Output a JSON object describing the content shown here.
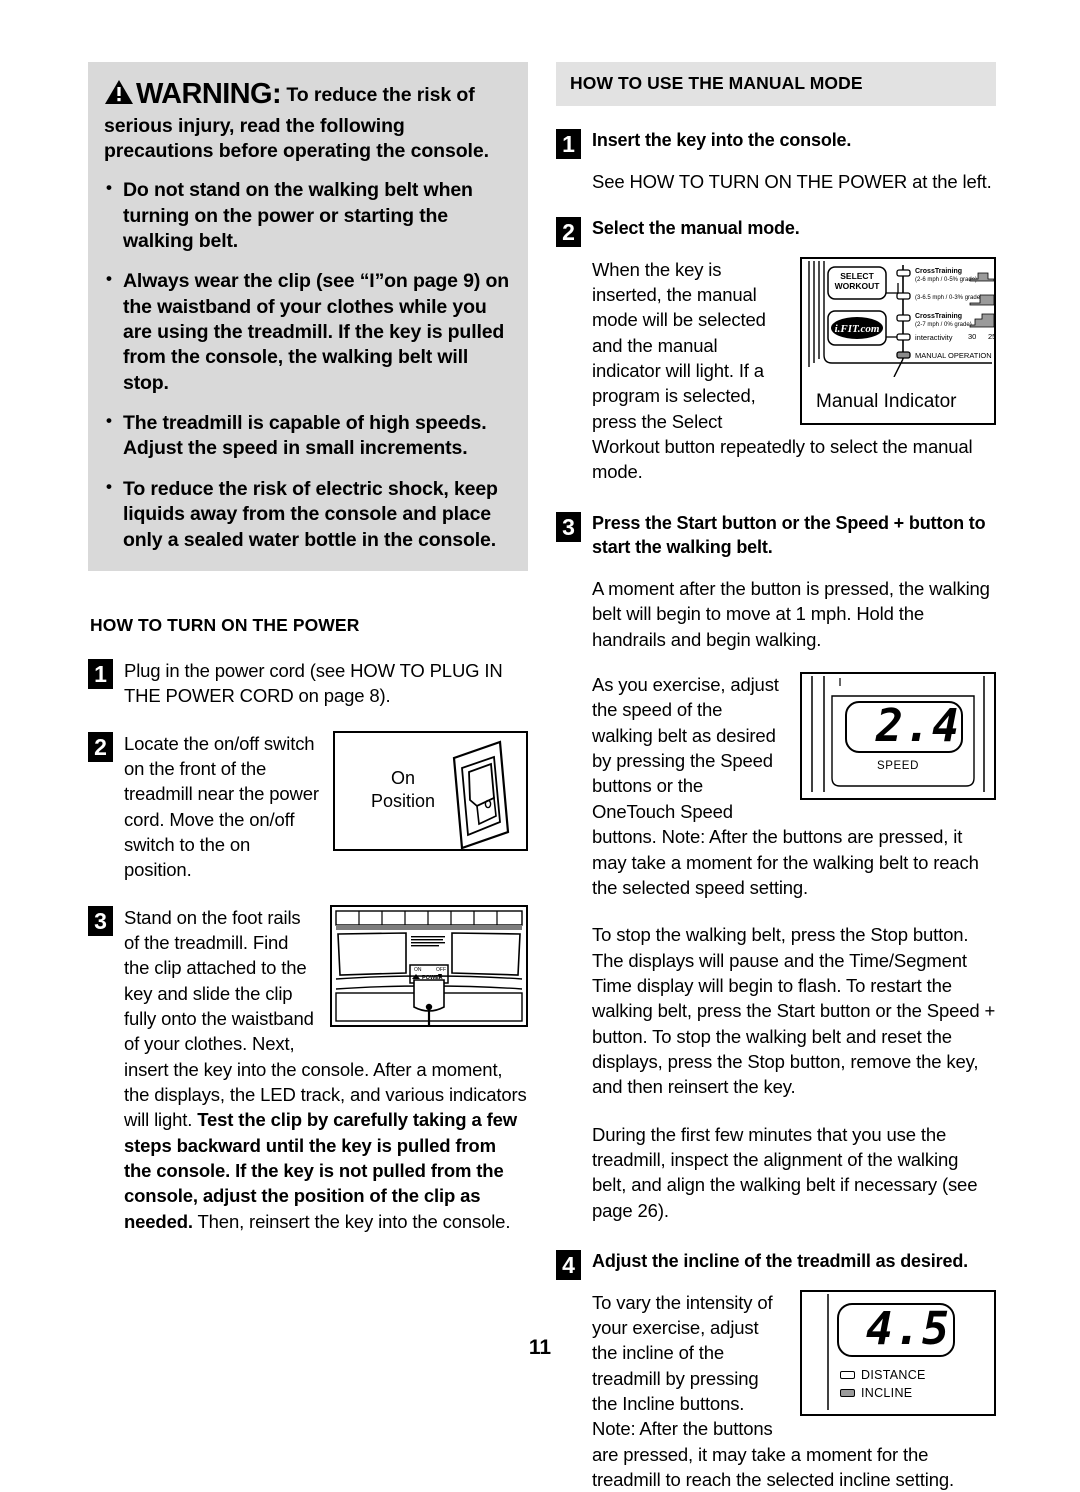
{
  "page": {
    "number": "11"
  },
  "left_column": {
    "warning": {
      "icon": "warning-triangle-icon",
      "word": "WARNING",
      "colon": ":",
      "lead": " To reduce the risk of serious injury, read the following precautions before operating the console.",
      "bullets": [
        "Do not stand on the walking belt when turning on the power or starting the walking belt.",
        "Always wear the clip (see “I”on page 9) on the waistband of your clothes while you are using the treadmill. If the key is pulled from the console, the walking belt will stop.",
        "The treadmill is capable of high speeds. Adjust the speed in small increments.",
        "To reduce the risk of electric shock, keep liquids away from the console and place only a sealed water bottle in the console."
      ]
    },
    "section_title": "HOW TO TURN ON THE POWER",
    "steps": [
      {
        "number": "1",
        "text": "Plug in the power cord (see HOW TO PLUG IN THE POWER CORD on page 8)."
      },
      {
        "number": "2",
        "text": "Locate the on/off switch on the front of the treadmill near the power cord. Move the on/off switch to the on position."
      },
      {
        "number": "3",
        "text_part1": "Stand on the foot rails of the treadmill. Find the clip attached to the key and slide the clip fully onto the waistband of your clothes. Next, insert the key into the console. After a moment, the displays, the LED track, and various indicators will light. ",
        "text_bold": "Test the clip by carefully taking a few steps backward until the key is pulled from the console. If the key is not pulled from the console, adjust the position of the clip as needed.",
        "text_part2": " Then, reinsert the key into the console."
      }
    ],
    "switch_figure": {
      "label_line1": "On",
      "label_line2": "Position"
    },
    "treadmill_figure": {
      "power_on": "ON",
      "power_off": "OFF",
      "power_label": "POWER",
      "caution_text": "Important - Incline must be set at lowest level before folding treadmill into storage position."
    }
  },
  "right_column": {
    "section_title": "HOW TO USE THE MANUAL MODE",
    "steps": [
      {
        "number": "1",
        "heading": "Insert the key into the console.",
        "body": "See HOW TO TURN ON THE POWER at the left."
      },
      {
        "number": "2",
        "heading": "Select the manual mode.",
        "body": "When the key is inserted, the manual mode will be selected and the manual indicator will light. If a program is selected, press the Select Workout button repeatedly to select the manual mode."
      },
      {
        "number": "3",
        "heading": "Press the Start button or the Speed + button to start the walking belt.",
        "body1": "A moment after the button is pressed, the walking belt will begin to move at 1 mph. Hold the handrails and begin walking.",
        "body2": "As you exercise, adjust the speed of the walking belt as desired by pressing the Speed buttons or the OneTouch Speed buttons. Note: After the buttons are pressed, it may take a moment for the walking belt to reach the selected speed setting.",
        "body3": "To stop the walking belt, press the Stop button. The displays will pause and the Time/Segment Time display will begin to flash. To restart the walking belt, press the Start button or the Speed + button. To stop the walking belt and reset the displays, press the Stop button, remove the key, and then reinsert the key.",
        "body4": "During the first few minutes that you use the treadmill, inspect the alignment of the walking belt, and align the walking belt if necessary (see page 26)."
      },
      {
        "number": "4",
        "heading": "Adjust the incline of the treadmill as desired.",
        "body": "To vary the intensity of your exercise, adjust the incline of the treadmill by pressing the Incline buttons. Note: After the buttons are pressed, it may take a moment for the treadmill to reach the selected incline setting."
      }
    ],
    "console_figure": {
      "select_workout_line1": "SELECT",
      "select_workout_line2": "WORKOUT",
      "ifit_logo": "i.FIT.com",
      "programs": [
        {
          "name": "CrossTraining",
          "spec": "(2-6 mph / 0-5% grade)"
        },
        {
          "name": "",
          "spec": "(3-6.5 mph / 0-3% grade)"
        },
        {
          "name": "CrossTraining",
          "spec": "(2-7 mph / 0% grade)"
        }
      ],
      "interactivity": "interactivity",
      "manual_operation": "MANUAL OPERATION",
      "tick_labels": [
        "30",
        "25"
      ],
      "callout": "Manual Indicator"
    },
    "speed_figure": {
      "value": "2.4",
      "caption": "SPEED"
    },
    "incline_figure": {
      "value": "4.5",
      "indicators": [
        {
          "label": "DISTANCE",
          "lit": false
        },
        {
          "label": "INCLINE",
          "lit": true
        }
      ]
    }
  },
  "colors": {
    "warning_bg": "#d9d9d9",
    "banner_bg": "#e2e2e2",
    "ink": "#000000"
  }
}
